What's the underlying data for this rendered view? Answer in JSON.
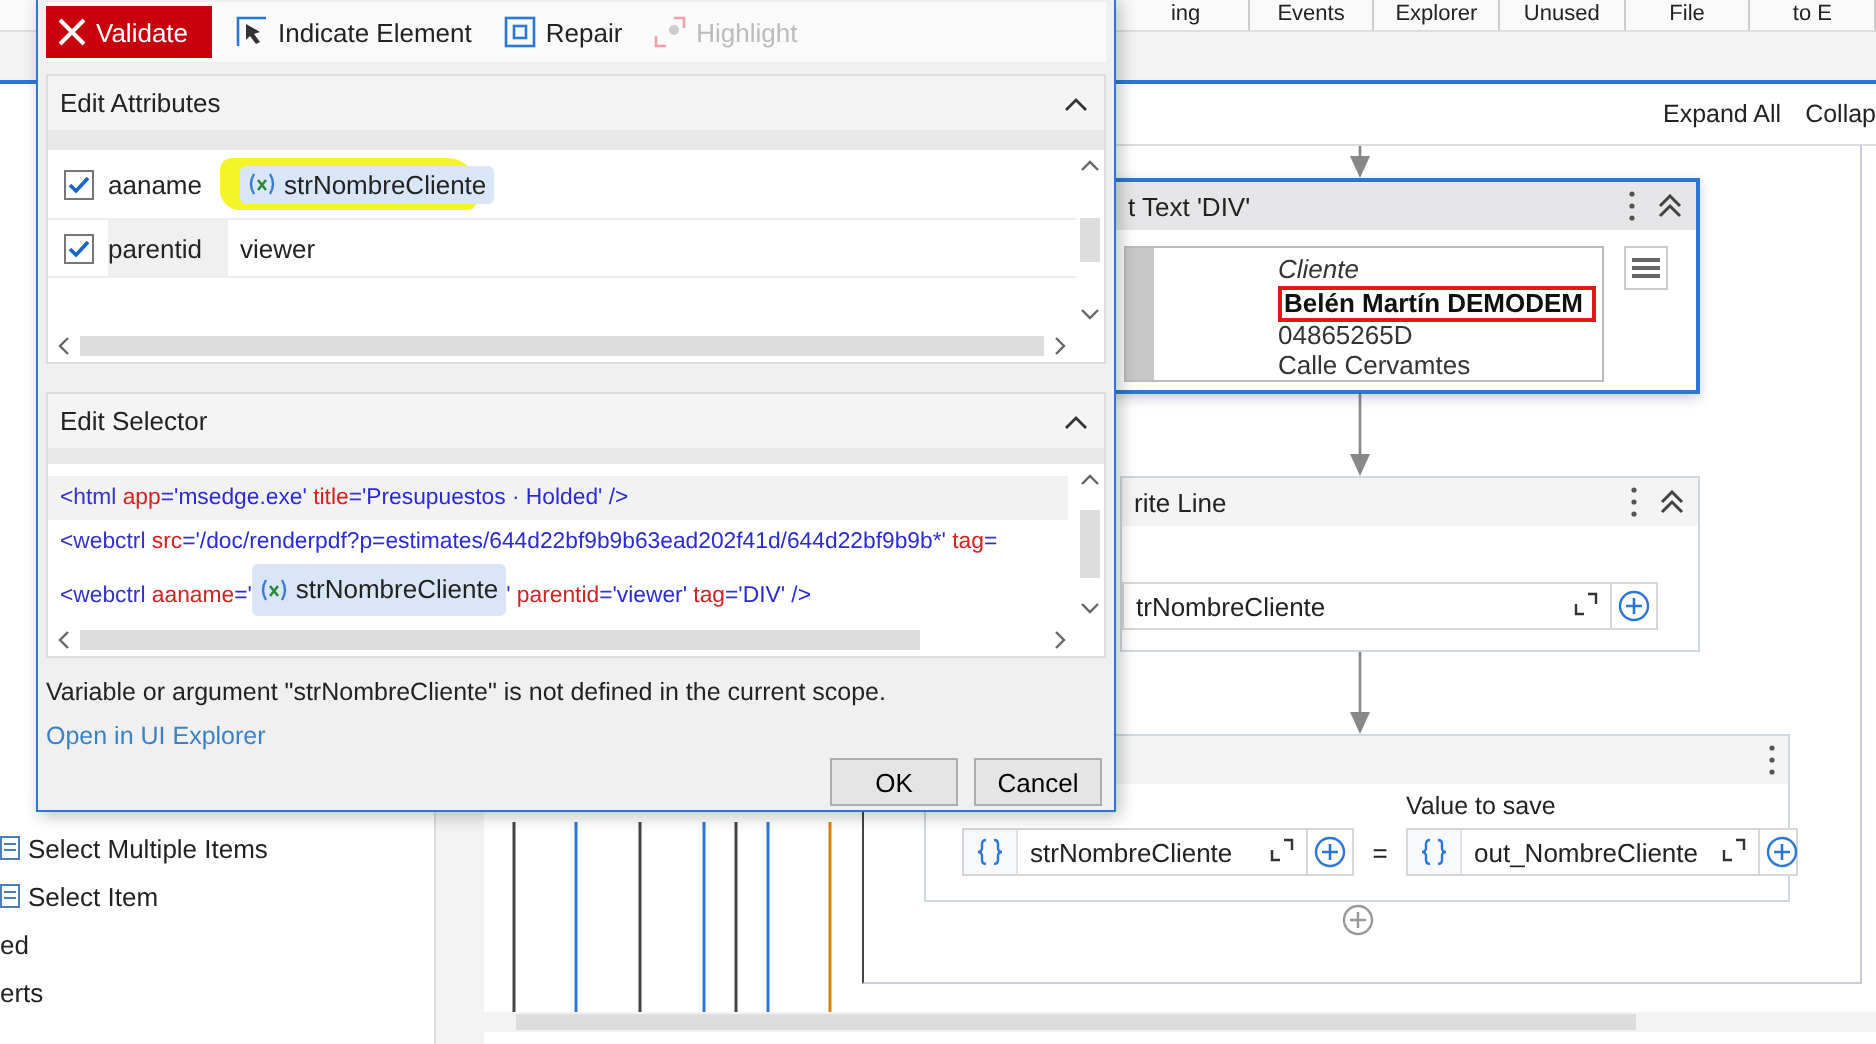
{
  "top_tabs": [
    {
      "label": "ing"
    },
    {
      "label": "Events"
    },
    {
      "label": "Explorer"
    },
    {
      "label": "Unused"
    },
    {
      "label": "File"
    },
    {
      "label": "to E"
    }
  ],
  "sidebar": {
    "items": [
      {
        "label": "Select Multiple Items",
        "kind": "activity"
      },
      {
        "label": "Select Item",
        "kind": "activity"
      },
      {
        "label": "ed",
        "kind": "category"
      },
      {
        "label": "erts",
        "kind": "category"
      }
    ]
  },
  "designer": {
    "toolbar": [
      "Expand All",
      "Collap"
    ],
    "activities": [
      {
        "kind": "get_text",
        "title": "t Text 'DIV'",
        "selected": true,
        "preview": {
          "label": "Cliente",
          "highlighted_line": "Belén Martín DEMODEM",
          "lines": [
            "04865265D",
            "Calle Cervamtes"
          ]
        }
      },
      {
        "kind": "write_line",
        "title": "rite Line",
        "selected": false,
        "field": "trNombreCliente"
      },
      {
        "kind": "assign",
        "selected": false,
        "value_label": "Value to save",
        "to": "strNombreCliente",
        "operator": "=",
        "value": "out_NombreCliente"
      }
    ]
  },
  "dialog": {
    "toolbar": [
      {
        "label": "Validate",
        "kind": "validate",
        "disabled": false
      },
      {
        "label": "Indicate Element",
        "kind": "indicate",
        "disabled": false
      },
      {
        "label": "Repair",
        "kind": "repair",
        "disabled": false
      },
      {
        "label": "Highlight",
        "kind": "highlight",
        "disabled": true
      }
    ],
    "edit_attributes": {
      "title": "Edit Attributes",
      "expanded": true,
      "rows": [
        {
          "name": "aaname",
          "checked": true,
          "value": "strNombreCliente",
          "kind": "variable",
          "marked": true
        },
        {
          "name": "parentid",
          "checked": true,
          "value": "viewer",
          "kind": "text",
          "marked": false
        }
      ]
    },
    "edit_selector": {
      "title": "Edit Selector",
      "expanded": true,
      "lines": [
        {
          "selected": true,
          "tokens": [
            {
              "text": "<html ",
              "kind": "tag"
            },
            {
              "text": "app",
              "kind": "attr"
            },
            {
              "text": "=",
              "kind": "tag"
            },
            {
              "text": "'msedge.exe' ",
              "kind": "value"
            },
            {
              "text": "title",
              "kind": "attr"
            },
            {
              "text": "=",
              "kind": "tag"
            },
            {
              "text": "'Presupuestos · Holded' />",
              "kind": "value"
            }
          ]
        },
        {
          "selected": false,
          "tokens": [
            {
              "text": "<webctrl ",
              "kind": "tag"
            },
            {
              "text": "src",
              "kind": "attr"
            },
            {
              "text": "=",
              "kind": "tag"
            },
            {
              "text": "'/doc/renderpdf?p=estimates/644d22bf9b9b63ead202f41d/644d22bf9b9b*' ",
              "kind": "value"
            },
            {
              "text": "tag",
              "kind": "attr"
            },
            {
              "text": "=",
              "kind": "tag"
            }
          ]
        },
        {
          "selected": false,
          "tokens": [
            {
              "text": "<webctrl ",
              "kind": "tag"
            },
            {
              "text": "aaname",
              "kind": "attr"
            },
            {
              "text": "='",
              "kind": "value"
            },
            {
              "text": "strNombreCliente",
              "kind": "variable"
            },
            {
              "text": "' ",
              "kind": "value"
            },
            {
              "text": "parentid",
              "kind": "attr"
            },
            {
              "text": "=",
              "kind": "tag"
            },
            {
              "text": "'viewer' ",
              "kind": "value"
            },
            {
              "text": "tag",
              "kind": "attr"
            },
            {
              "text": "=",
              "kind": "tag"
            },
            {
              "text": "'DIV' />",
              "kind": "value"
            }
          ]
        }
      ]
    },
    "message": "Variable or argument \"strNombreCliente\" is not defined in the current scope.",
    "link": "Open in UI Explorer",
    "buttons": [
      "OK",
      "Cancel"
    ]
  }
}
